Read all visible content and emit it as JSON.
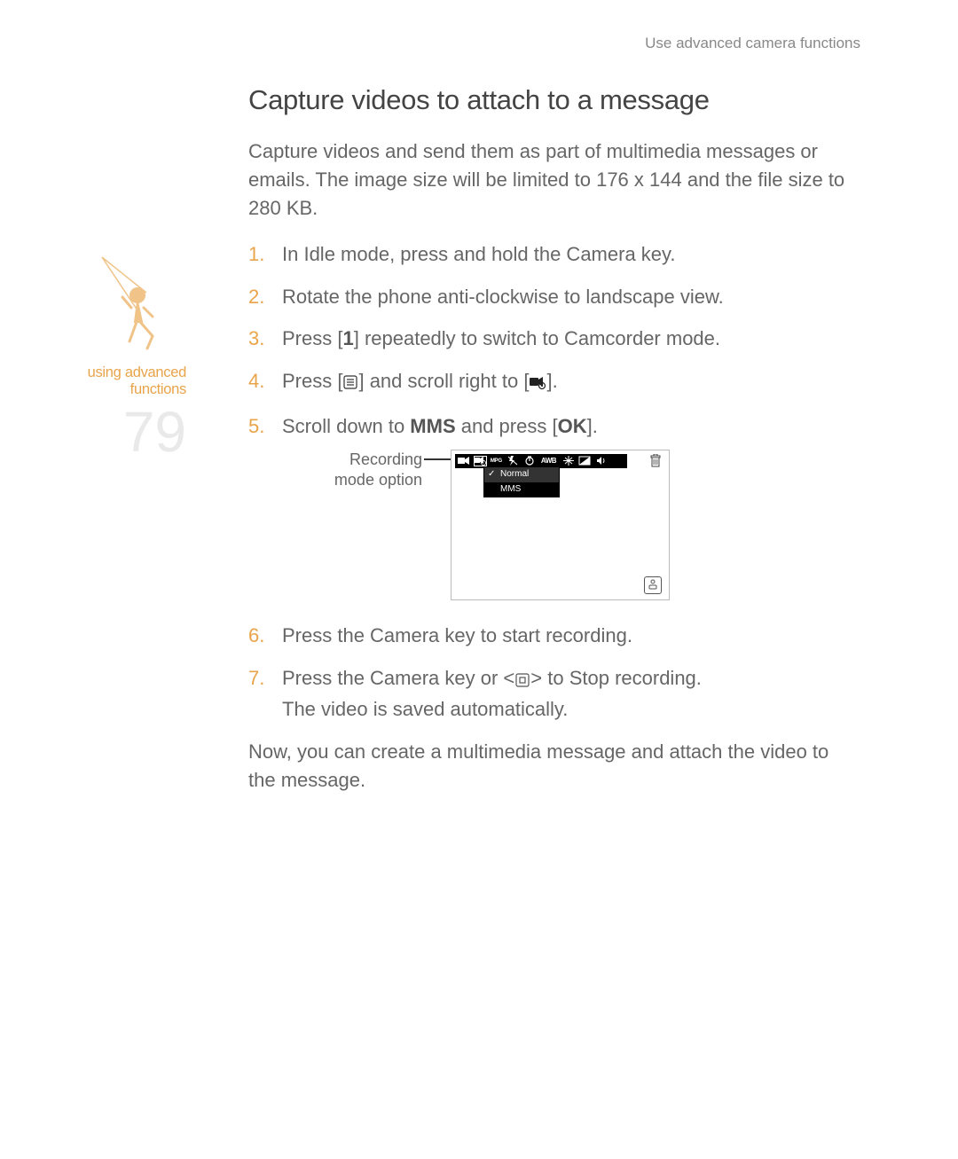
{
  "header_right": "Use advanced camera functions",
  "sidebar": {
    "caption_line1": "using advanced",
    "caption_line2": "functions",
    "page_number": "79"
  },
  "title": "Capture videos to attach to a message",
  "intro": "Capture videos and send them as part of multimedia messages or emails. The image size will be limited to 176 x 144 and the file size to 280 KB.",
  "steps": {
    "s1": "In Idle mode, press and hold the Camera key.",
    "s2": "Rotate the phone anti-clockwise to landscape view.",
    "s3_a": "Press [",
    "s3_bold": "1",
    "s3_b": "] repeatedly to switch to Camcorder mode.",
    "s4_a": "Press [",
    "s4_b": "] and scroll right to [",
    "s4_c": "].",
    "s5_a": "Scroll down to ",
    "s5_bold1": "MMS",
    "s5_b": " and press [",
    "s5_bold2": "OK",
    "s5_c": "].",
    "s6": "Press the Camera key to start recording.",
    "s7_a": "Press the Camera key or <",
    "s7_b": "> to Stop recording.",
    "s7_line2": "The video is saved automatically."
  },
  "figure": {
    "label_line1": "Recording",
    "label_line2": "mode option",
    "dropdown_normal": "Normal",
    "dropdown_mms": "MMS",
    "iconbar_awb": "AWB",
    "iconbar_mpeg": "ᴹᴾᴳ"
  },
  "conclusion": "Now, you can create a multimedia message and attach the video to the message."
}
